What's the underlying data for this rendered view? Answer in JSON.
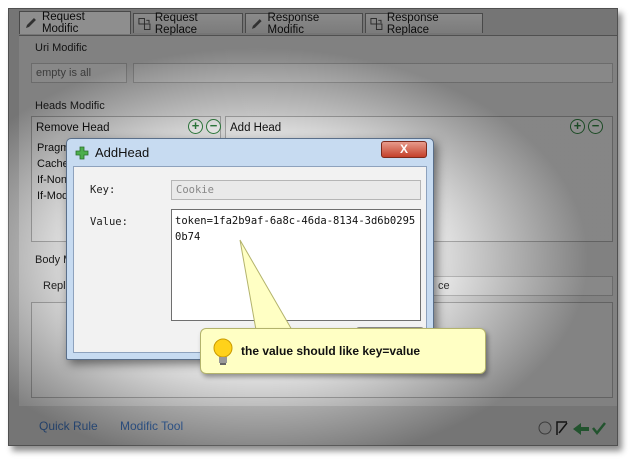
{
  "tabs": [
    {
      "label": "Request Modific",
      "icon": "pencil-icon",
      "active": true
    },
    {
      "label": "Request Replace",
      "icon": "replace-icon",
      "active": false
    },
    {
      "label": "Response Modific",
      "icon": "pencil-icon",
      "active": false
    },
    {
      "label": "Response Replace",
      "icon": "replace-icon",
      "active": false
    }
  ],
  "uri": {
    "group_label": "Uri Modific",
    "field_placeholder": "empty is all"
  },
  "heads": {
    "group_label": "Heads Modific",
    "remove_head": {
      "title": "Remove Head",
      "items": [
        "Pragm",
        "Cache",
        "If-Non",
        "If-Mod"
      ]
    },
    "add_head": {
      "title": "Add Head"
    }
  },
  "body": {
    "group_label": "Body M",
    "replace_label": "Repla",
    "right_fragment": "ce"
  },
  "bottom": {
    "quick_rule": "Quick Rule",
    "modific_tool": "Modific Tool"
  },
  "dialog": {
    "title": "AddHead",
    "close": "X",
    "key_label": "Key:",
    "key_value": "Cookie",
    "value_label": "Value:",
    "value_text": "token=1fa2b9af-6a8c-46da-8134-3d6b02950b74"
  },
  "callout": {
    "text": "the value should like key=value"
  },
  "colors": {
    "accent_green": "#2f7f3f",
    "close_red": "#c4402a",
    "callout_bg": "#ffffc4",
    "link_blue": "#3d6fb5"
  }
}
